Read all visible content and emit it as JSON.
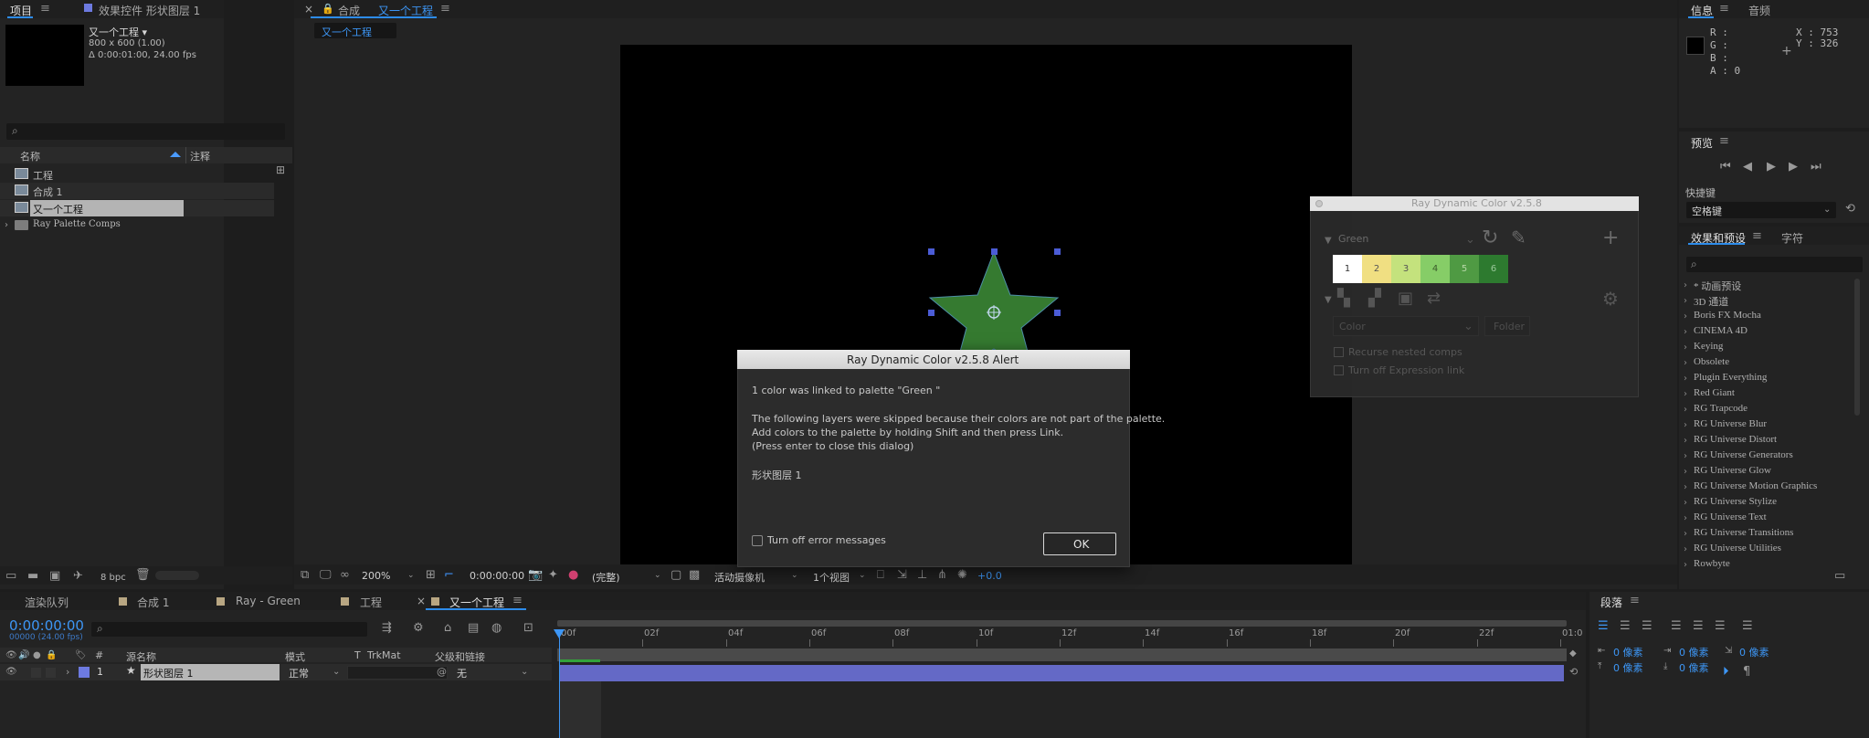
{
  "project_panel": {
    "tab_label": "项目",
    "effects_tab_label": "效果控件 形状图层 1",
    "comp_name": "又一个工程 ▾",
    "comp_size": "800 x 600 (1.00)",
    "comp_duration": "Δ 0:00:01:00, 24.00 fps",
    "col_name": "名称",
    "col_comment": "注释",
    "items": [
      {
        "label": "工程",
        "type": "comp"
      },
      {
        "label": "合成 1",
        "type": "comp"
      },
      {
        "label": "又一个工程",
        "type": "comp"
      },
      {
        "label": "Ray Palette Comps",
        "type": "folder"
      }
    ],
    "bpc": "8 bpc"
  },
  "comp_panel": {
    "close": "×",
    "tab_prefix": "合成",
    "tab_comp_name": "又一个工程",
    "breadcrumb": "又一个工程",
    "zoom": "200%",
    "timecode": "0:00:00:00",
    "resolution": "(完整)",
    "camera": "活动摄像机",
    "views": "1个视图",
    "exposure": "+0.0"
  },
  "alert_dialog": {
    "title": "Ray Dynamic Color v2.5.8 Alert",
    "line1": "1 color was linked to palette \"Green \"",
    "line2": "The following layers were skipped because their colors are not part of the palette.",
    "line3": "Add colors to the palette by holding Shift and then press Link.",
    "line4": "(Press enter to close this dialog)",
    "skipped_layer": "形状图层 1",
    "checkbox_label": "Turn off error messages",
    "ok_label": "OK"
  },
  "ray_panel": {
    "title": "Ray Dynamic Color v2.5.8",
    "palette_name": "Green",
    "swatches": [
      {
        "label": "1",
        "color": "#ffffff"
      },
      {
        "label": "2",
        "color": "#f0df82"
      },
      {
        "label": "3",
        "color": "#c4e27d"
      },
      {
        "label": "4",
        "color": "#86cd67"
      },
      {
        "label": "5",
        "color": "#4f9a43"
      },
      {
        "label": "6",
        "color": "#2d7a2f"
      }
    ],
    "dropdown_color": "Color",
    "folder_label": "Folder",
    "check1": "Recurse nested comps",
    "check2": "Turn off Expression link"
  },
  "info_panel": {
    "tab_info": "信息",
    "tab_audio": "音频",
    "r": "R :",
    "g": "G :",
    "b": "B :",
    "a": "A : 0",
    "x": "X : 753",
    "y": "Y : 326"
  },
  "preview_panel": {
    "title": "预览",
    "shortcut_label": "快捷键",
    "shortcut_value": "空格键"
  },
  "effects_panel": {
    "tab_effects": "效果和预设",
    "tab_char": "字符",
    "items": [
      "* 动画预设",
      "3D 通道",
      "Boris FX Mocha",
      "CINEMA 4D",
      "Keying",
      "Obsolete",
      "Plugin Everything",
      "Red Giant",
      "RG Trapcode",
      "RG Universe Blur",
      "RG Universe Distort",
      "RG Universe Generators",
      "RG Universe Glow",
      "RG Universe Motion Graphics",
      "RG Universe Stylize",
      "RG Universe Text",
      "RG Universe Transitions",
      "RG Universe Utilities",
      "Rowbyte"
    ]
  },
  "timeline": {
    "tabs": [
      "渲染队列",
      "合成 1",
      "Ray - Green",
      "工程",
      "又一个工程"
    ],
    "timecode": "0:00:00:00",
    "timecode_sub": "00000 (24.00 fps)",
    "col_source": "源名称",
    "col_mode": "模式",
    "col_t": "T",
    "col_trkmat": "TrkMat",
    "col_parent": "父级和链接",
    "col_hash": "#",
    "layer_num": "1",
    "layer_name": "形状图层 1",
    "layer_mode": "正常",
    "layer_parent": "无",
    "ruler": [
      "00f",
      "02f",
      "04f",
      "06f",
      "08f",
      "10f",
      "12f",
      "14f",
      "16f",
      "18f",
      "20f",
      "22f",
      "01:0"
    ]
  },
  "paragraph_panel": {
    "title": "段落",
    "px1": "0 像素",
    "px2": "0 像素",
    "px3": "0 像素",
    "px4": "0 像素",
    "px5": "0 像素"
  }
}
